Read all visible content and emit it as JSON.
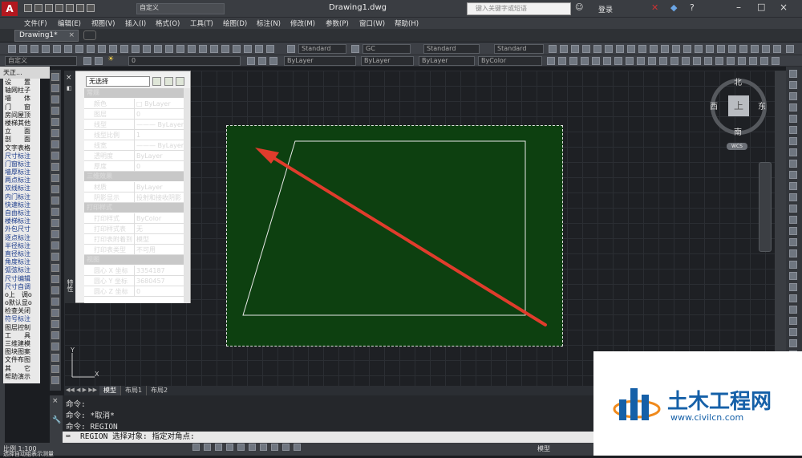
{
  "app": {
    "file_title": "Drawing1.dwg",
    "workspace": "自定义",
    "search_placeholder": "键入关键字或短语",
    "login": "登录",
    "logo_letter": "A"
  },
  "menu": [
    "文件(F)",
    "编辑(E)",
    "视图(V)",
    "插入(I)",
    "格式(O)",
    "工具(T)",
    "绘图(D)",
    "标注(N)",
    "修改(M)",
    "参数(P)",
    "窗口(W)",
    "帮助(H)"
  ],
  "doc_tab": "Drawing1*",
  "toolbar": {
    "style1": "Standard",
    "style2": "GC",
    "style3": "Standard",
    "style4": "Standard",
    "workspace2": "自定义",
    "layer": "0",
    "color": "ByLayer",
    "linetype": "ByLayer",
    "lineweight": "ByLayer",
    "plotstyle": "ByColor"
  },
  "tz": {
    "header": "天正...",
    "items": [
      "设　　置",
      "轴网柱子",
      "墙　　体",
      "门　　窗",
      "房间屋顶",
      "楼梯其他",
      "立　　面",
      "剖　　面",
      "文字表格",
      "尺寸标注",
      "门窗标注",
      "墙厚标注",
      "两点标注",
      "双线标注",
      "内门标注",
      "快速标注",
      "自由标注",
      "楼梯标注",
      "外包尺寸",
      "逐点标注",
      "半径标注",
      "直径标注",
      "角度标注",
      "弧弦标注",
      "尺寸编辑",
      "尺寸自调",
      "o上　调o",
      "o默认显o",
      "检查关闭",
      "符号标注",
      "图层控制",
      "工　　具",
      "三维建模",
      "图块图案",
      "文件布图",
      "其　　它",
      "帮助演示"
    ]
  },
  "properties": {
    "selection": "无选择",
    "side_label": "特性",
    "sections": [
      {
        "title": "常规",
        "rows": [
          [
            "颜色",
            "□ ByLayer"
          ],
          [
            "图层",
            "0"
          ],
          [
            "线型",
            "——— ByLayer"
          ],
          [
            "线型比例",
            "1"
          ],
          [
            "线宽",
            "——— ByLayer"
          ],
          [
            "透明度",
            "ByLayer"
          ],
          [
            "厚度",
            "0"
          ]
        ]
      },
      {
        "title": "三维效果",
        "rows": [
          [
            "材质",
            "ByLayer"
          ],
          [
            "阴影显示",
            "投射和接收阴影"
          ]
        ]
      },
      {
        "title": "打印样式",
        "rows": [
          [
            "打印样式",
            "ByColor"
          ],
          [
            "打印样式表",
            "无"
          ],
          [
            "打印表附着到",
            "模型"
          ],
          [
            "打印表类型",
            "不可用"
          ]
        ]
      },
      {
        "title": "视图",
        "rows": [
          [
            "圆心 X 坐标",
            "3354187"
          ],
          [
            "圆心 Y 坐标",
            "3680457"
          ],
          [
            "圆心 Z 坐标",
            "0"
          ]
        ]
      }
    ]
  },
  "viewcube": {
    "north": "北",
    "south": "南",
    "east": "东",
    "west": "西",
    "top": "上",
    "wcs": "WCS"
  },
  "ucs": {
    "x": "X",
    "y": "Y"
  },
  "layout_tabs": [
    "模型",
    "布局1",
    "布局2"
  ],
  "command": {
    "lines": [
      "命令:",
      "命令: *取消*",
      "命令: REGION"
    ],
    "prompt": "REGION 选择对象: 指定对角点:"
  },
  "status": {
    "scale": "比例 1:100",
    "left_text": "选择自动组表示测量",
    "model": "模型"
  },
  "brand": {
    "name": "土木工程网",
    "url": "www.civilcn.com",
    "colors": {
      "blue": "#1560a8",
      "orange": "#f08a1c"
    }
  },
  "colors": {
    "region_fill": "#0d4010",
    "arrow": "#e03c2c",
    "canvas": "#1e2024"
  }
}
